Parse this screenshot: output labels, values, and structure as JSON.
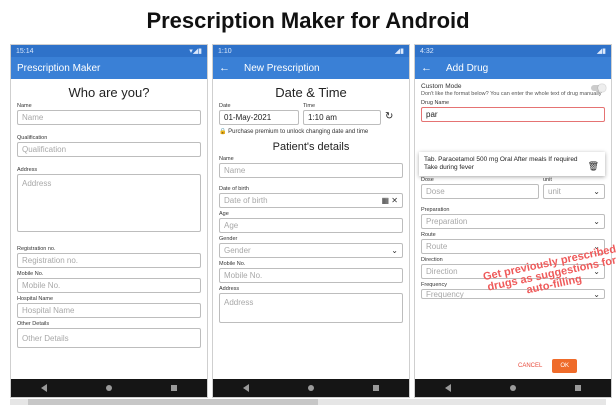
{
  "banner": {
    "title": "Prescription Maker for Android"
  },
  "phone1": {
    "status_time": "15:14",
    "appbar_title": "Prescription Maker",
    "heading": "Who are you?",
    "fields": [
      {
        "label": "Name",
        "placeholder": "Name"
      },
      {
        "label": "Qualification",
        "placeholder": "Qualification"
      },
      {
        "label": "Address",
        "placeholder": "Address"
      },
      {
        "label": "Registration no.",
        "placeholder": "Registration no."
      },
      {
        "label": "Mobile No.",
        "placeholder": "Mobile No."
      },
      {
        "label": "Hospital Name",
        "placeholder": "Hospital Name"
      },
      {
        "label": "Other Details",
        "placeholder": "Other Details"
      }
    ]
  },
  "phone2": {
    "status_time": "1:10",
    "appbar_title": "New Prescription",
    "heading_date": "Date & Time",
    "date_label": "Date",
    "date_value": "01-May-2021",
    "time_label": "Time",
    "time_value": "1:10 am",
    "premium_note": "Purchase premium to unlock changing date and time",
    "heading_patient": "Patient's details",
    "fields": [
      {
        "label": "Name",
        "placeholder": "Name"
      },
      {
        "label": "Date of birth",
        "placeholder": "Date of birth"
      },
      {
        "label": "Age",
        "placeholder": "Age"
      },
      {
        "label": "Gender",
        "placeholder": "Gender"
      },
      {
        "label": "Mobile No.",
        "placeholder": "Mobile No."
      },
      {
        "label": "Address",
        "placeholder": "Address"
      }
    ]
  },
  "phone3": {
    "status_time": "4:32",
    "appbar_title": "Add Drug",
    "custom_mode_label": "Custom Mode",
    "custom_mode_desc": "Don't like the format below? You can enter the whole text of drug manually",
    "drug_name_label": "Drug Name",
    "drug_name_value": "par",
    "suggestion": {
      "line1": "Tab. Paracetamol 500 mg Oral After meals If required",
      "line2": "Take during fever"
    },
    "dose_label": "Dose",
    "dose_placeholder": "Dose",
    "unit_label": "unit",
    "unit_placeholder": "unit",
    "preparation_label": "Preparation",
    "preparation_placeholder": "Preparation",
    "route_label": "Route",
    "route_placeholder": "Route",
    "direction_label": "Direction",
    "direction_placeholder": "Direction",
    "frequency_label": "Frequency",
    "frequency_placeholder": "Frequency",
    "cancel_label": "CANCEL",
    "ok_label": "OK",
    "overlay_text": "Get previously prescribed drugs as suggestions for auto-filling"
  },
  "colors": {
    "appbar": "#3a80d6",
    "status": "#2f72c9",
    "accent_red": "#ef5a5a",
    "ok_button": "#ef6b2a"
  }
}
